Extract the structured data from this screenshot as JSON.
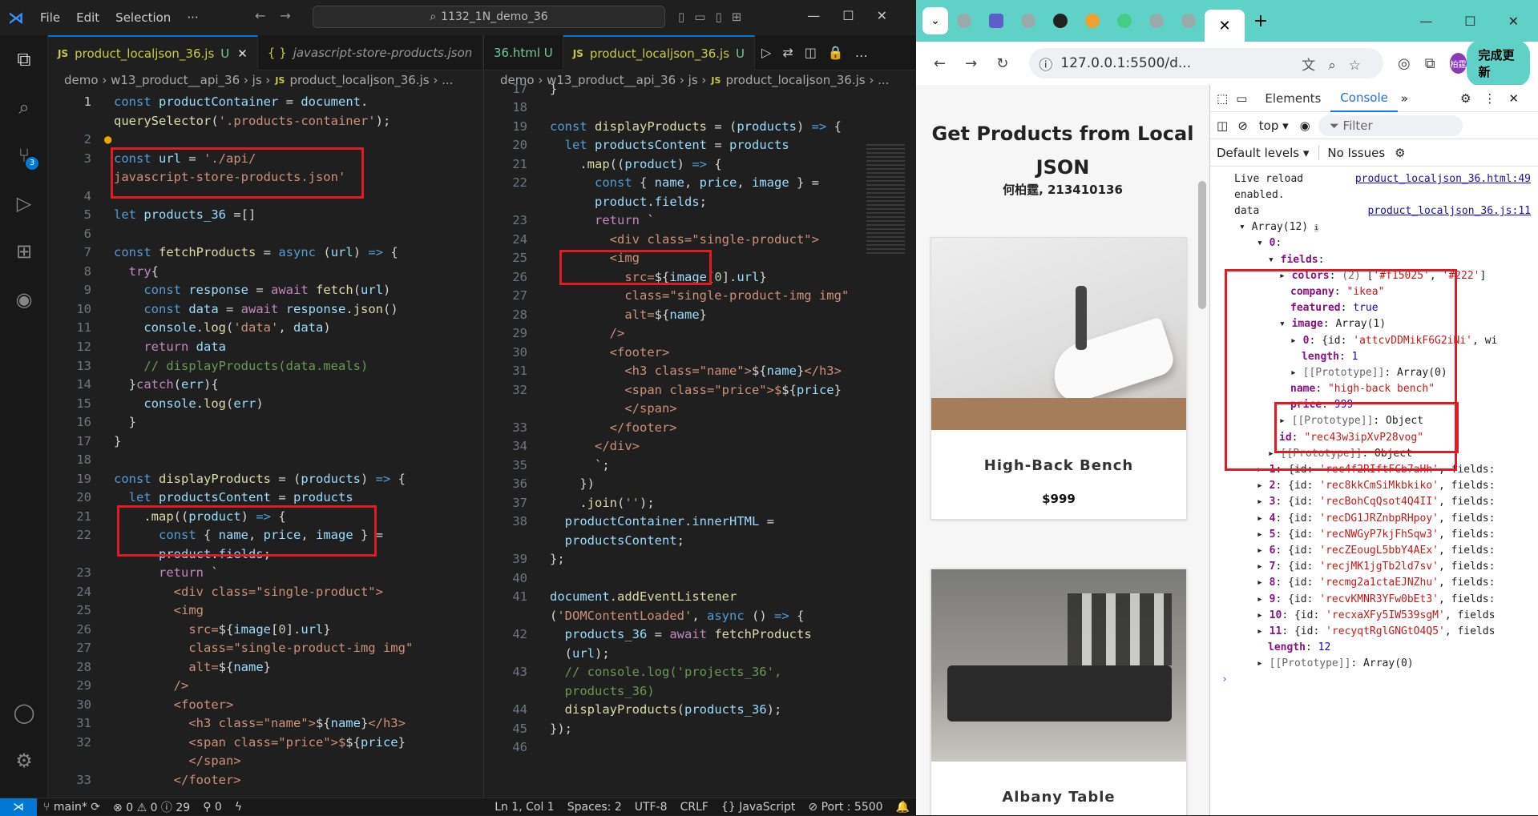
{
  "vscode": {
    "menu": [
      "File",
      "Edit",
      "Selection",
      "···"
    ],
    "search": "1132_1N_demo_36",
    "explorer_badge": "3",
    "pane1": {
      "tabs": [
        {
          "label": "product_localjson_36.js",
          "mod": "U",
          "active": true
        },
        {
          "label": "javascript-store-products.json",
          "mod": "",
          "active": false
        }
      ],
      "breadcrumb": [
        "demo",
        "w13_product__api_36",
        "js",
        "product_localjson_36.js",
        "..."
      ]
    },
    "pane2": {
      "tabs": [
        {
          "label": "36.html U",
          "active": false
        },
        {
          "label": "product_localjson_36.js",
          "mod": "U",
          "active": true
        }
      ],
      "breadcrumb": [
        "demo",
        "w13_product__api_36",
        "js",
        "product_localjson_36.js",
        "..."
      ]
    },
    "status": {
      "branch": "main*",
      "problems": "⊗ 0 ⚠ 0 ⓘ 29",
      "ports_count": "0",
      "position": "Ln 1, Col 1",
      "spaces": "Spaces: 2",
      "encoding": "UTF-8",
      "eol": "CRLF",
      "language": "JavaScript",
      "port": "Port : 5500"
    }
  },
  "chrome": {
    "url": "127.0.0.1:5500/d...",
    "update_label": "完成更新",
    "profile": "柏霆",
    "page": {
      "title": "Get Products from Local JSON",
      "subtitle": "何柏霆, 213410136",
      "products": [
        {
          "name": "High-Back Bench",
          "price": "$999"
        },
        {
          "name": "Albany Table",
          "price": ""
        }
      ]
    },
    "devtools": {
      "tabs": [
        "Elements",
        "Console"
      ],
      "context": "top",
      "filter_placeholder": "Filter",
      "levels": "Default levels",
      "issues": "No Issues",
      "live_reload": "Live reload enabled.",
      "live_reload_link": "product_localjson_36.html:49",
      "data_label": "data",
      "data_link": "product_localjson_36.js:11"
    }
  }
}
